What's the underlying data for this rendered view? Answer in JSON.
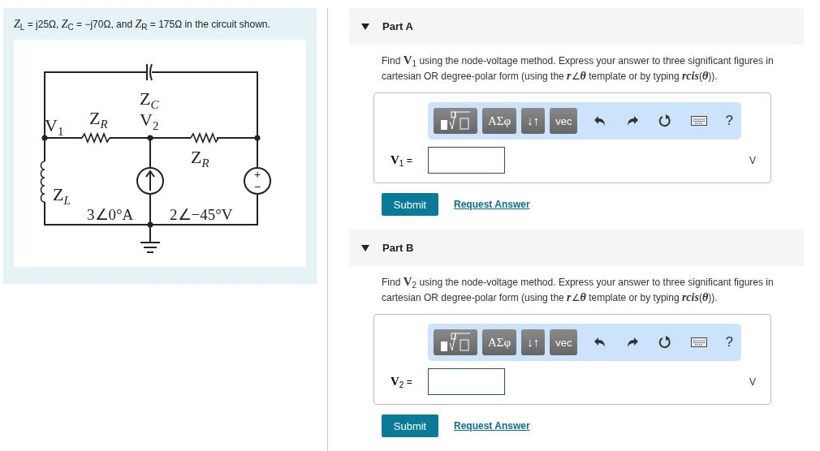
{
  "problem": {
    "text": "*Z*$_{L}$ = j25Ω, *Z*$_{C}$ = −j70Ω, and *Z*$_{R}$ = 175Ω in the circuit shown.",
    "circuit": {
      "labels": [
        {
          "main": "Z",
          "sub": "C"
        },
        {
          "main": "V",
          "sub": "1"
        },
        {
          "main": "Z",
          "sub": "R"
        },
        {
          "main": "V",
          "sub": "2"
        },
        {
          "main": "Z",
          "sub": "R"
        },
        {
          "main": "Z",
          "sub": "L"
        },
        {
          "main": "3∠0°A"
        },
        {
          "main": "2∠−45°V"
        }
      ],
      "source_signs": [
        "+",
        "−"
      ]
    }
  },
  "parts": [
    {
      "title": "Part A",
      "expanded": true,
      "prompt": "Find **V**$_{1}$ using the node-voltage method.  Express your answer to three significant figures in cartesian OR degree-polar form (using the *r*∠*θ* template or by typing *rcis*(*θ*)).",
      "toolbar": [
        "ΑΣφ",
        "↓↑",
        "vec",
        "?"
      ],
      "answer_label": "**V**$_{1}$ =",
      "unit": "V",
      "submit": "Submit",
      "request": "Request Answer"
    },
    {
      "title": "Part B",
      "expanded": true,
      "prompt": "Find **V**$_{2}$ using the node-voltage method.  Express your answer to three significant figures in cartesian OR degree-polar form (using the *r*∠*θ* template or by typing *rcis*(*θ*)).",
      "toolbar": [
        "ΑΣφ",
        "↓↑",
        "vec",
        "?"
      ],
      "answer_label": "**V**$_{2}$ =",
      "unit": "V",
      "submit": "Submit",
      "request": "Request Answer"
    }
  ]
}
